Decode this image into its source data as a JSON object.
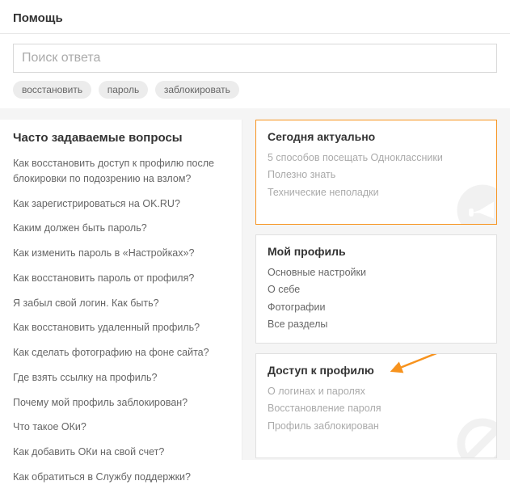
{
  "header": {
    "title": "Помощь"
  },
  "search": {
    "placeholder": "Поиск ответа",
    "tags": [
      "восстановить",
      "пароль",
      "заблокировать"
    ]
  },
  "faq": {
    "title": "Часто задаваемые вопросы",
    "items": [
      "Как восстановить доступ к профилю после блокировки по подозрению на взлом?",
      "Как зарегистрироваться на OK.RU?",
      "Каким должен быть пароль?",
      "Как изменить пароль в «Настройках»?",
      "Как восстановить пароль от профиля?",
      "Я забыл свой логин. Как быть?",
      "Как восстановить удаленный профиль?",
      "Как сделать фотографию на фоне сайта?",
      "Где взять ссылку на профиль?",
      "Почему мой профиль заблокирован?",
      "Что такое ОКи?",
      "Как добавить ОКи на свой счет?",
      "Как обратиться в Службу поддержки?"
    ]
  },
  "cards": [
    {
      "title": "Сегодня актуально",
      "links": [
        "5 способов посещать Одноклассники",
        "Полезно знать",
        "Технические неполадки"
      ],
      "highlight": true,
      "icon": "megaphone"
    },
    {
      "title": "Мой профиль",
      "links": [
        "Основные настройки",
        "О себе",
        "Фотографии",
        "Все разделы"
      ],
      "highlight": false
    },
    {
      "title": "Доступ к профилю",
      "links": [
        "О логинах и паролях",
        "Восстановление пароля",
        "Профиль заблокирован"
      ],
      "highlight": false,
      "icon": "nosign",
      "arrow": true
    }
  ]
}
